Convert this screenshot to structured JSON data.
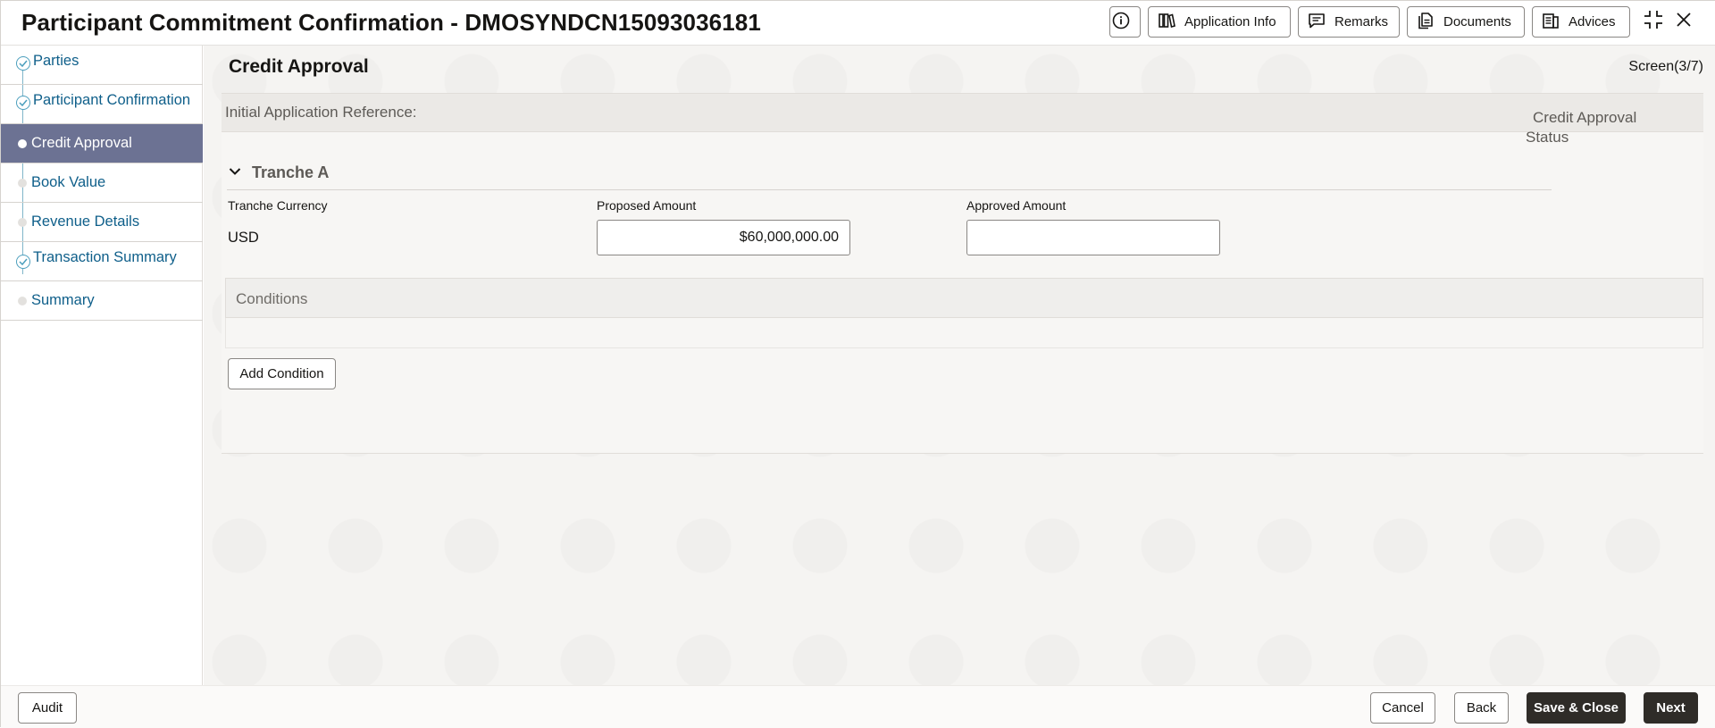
{
  "header": {
    "title": "Participant Commitment Confirmation - DMOSYNDCN15093036181",
    "buttons": {
      "application_info": "Application Info",
      "remarks": "Remarks",
      "documents": "Documents",
      "advices": "Advices"
    }
  },
  "sidebar": {
    "items": [
      {
        "label": "Parties",
        "state": "completed"
      },
      {
        "label": "Participant Confirmation",
        "state": "completed"
      },
      {
        "label": "Credit Approval",
        "state": "active"
      },
      {
        "label": "Book Value",
        "state": "pending"
      },
      {
        "label": "Revenue Details",
        "state": "pending"
      },
      {
        "label": "Transaction Summary",
        "state": "completed"
      },
      {
        "label": "Summary",
        "state": "pending"
      }
    ]
  },
  "main": {
    "section_title": "Credit Approval",
    "screen_indicator": "Screen(3/7)",
    "initial_application_reference_label": "Initial Application Reference:",
    "credit_approval_status_label": "Credit Approval Status",
    "tranche": {
      "title": "Tranche A",
      "currency_label": "Tranche Currency",
      "currency_value": "USD",
      "proposed_amount_label": "Proposed Amount",
      "proposed_amount_value": "$60,000,000.00",
      "approved_amount_label": "Approved Amount",
      "approved_amount_value": ""
    },
    "conditions_label": "Conditions",
    "add_condition_label": "Add Condition"
  },
  "footer": {
    "audit": "Audit",
    "cancel": "Cancel",
    "back": "Back",
    "save_close": "Save & Close",
    "next": "Next"
  },
  "colors": {
    "active_step_bg": "#6c7293",
    "link_text": "#0f5f8a",
    "primary_button": "#2f2c28"
  }
}
